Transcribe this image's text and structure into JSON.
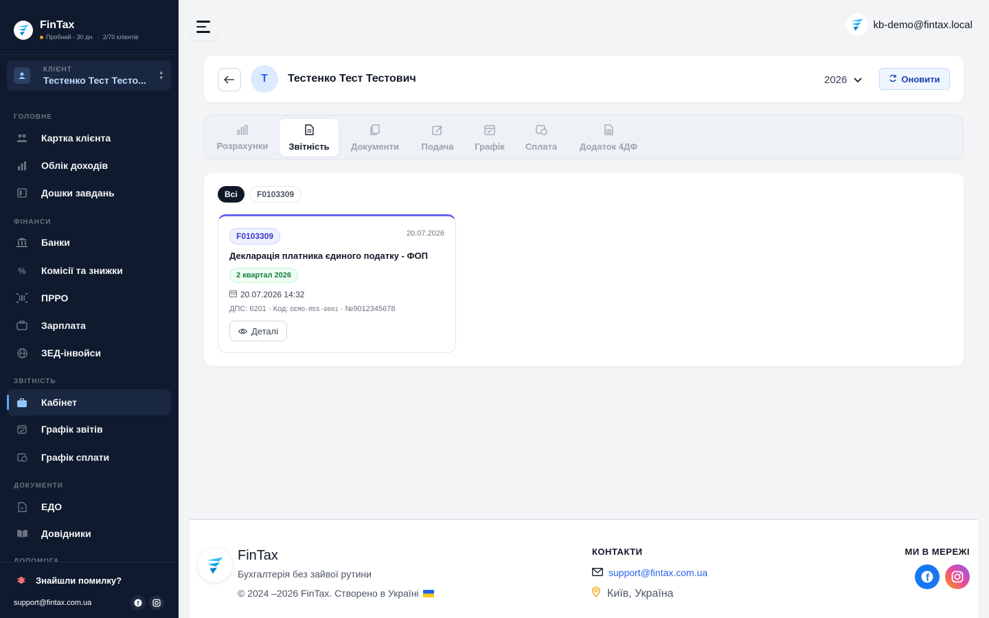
{
  "brand": {
    "name": "FinTax",
    "plan": "Пробний - 30 дн.",
    "clients": "2/70 клієнтів"
  },
  "client_selector": {
    "caption": "КЛІЄНТ",
    "name": "Тестенко Тест Тесто..."
  },
  "sidebar": {
    "sections": [
      {
        "title": "ГОЛОВНЕ",
        "items": [
          {
            "label": "Картка клієнта",
            "icon": "users-icon"
          },
          {
            "label": "Облік доходів",
            "icon": "bar-chart-icon"
          },
          {
            "label": "Дошки завдань",
            "icon": "board-icon"
          }
        ]
      },
      {
        "title": "ФІНАНСИ",
        "items": [
          {
            "label": "Банки",
            "icon": "bank-icon"
          },
          {
            "label": "Комісії та знижки",
            "icon": "percent-icon"
          },
          {
            "label": "ПРРО",
            "icon": "barcode-icon"
          },
          {
            "label": "Зарплата",
            "icon": "wallet-icon"
          },
          {
            "label": "ЗЕД-інвойси",
            "icon": "globe-icon"
          }
        ]
      },
      {
        "title": "ЗВІТНІСТЬ",
        "items": [
          {
            "label": "Кабінет",
            "icon": "briefcase-icon",
            "active": true
          },
          {
            "label": "Графік звітів",
            "icon": "calendar-check-icon"
          },
          {
            "label": "Графік сплати",
            "icon": "calendar-money-icon"
          }
        ]
      },
      {
        "title": "ДОКУМЕНТИ",
        "items": [
          {
            "label": "ЕДО",
            "icon": "document-sign-icon"
          },
          {
            "label": "Довідники",
            "icon": "book-icon"
          }
        ]
      },
      {
        "title": "ДОПОМОГА",
        "items": []
      }
    ],
    "bug_report": "Знайшли помилку?",
    "support_email": "support@fintax.com.ua"
  },
  "topbar": {
    "user_email": "kb-demo@fintax.local"
  },
  "header": {
    "avatar_letter": "Т",
    "client_full_name": "Тестенко Тест Тестович",
    "year": "2026",
    "refresh_label": "Оновити"
  },
  "tabs": [
    {
      "label": "Розрахунки",
      "icon": "bar-chart-icon"
    },
    {
      "label": "Звітність",
      "icon": "document-icon",
      "active": true
    },
    {
      "label": "Документи",
      "icon": "copy-icon"
    },
    {
      "label": "Подача",
      "icon": "edit-icon"
    },
    {
      "label": "Графік",
      "icon": "calendar-check-icon"
    },
    {
      "label": "Сплата",
      "icon": "calendar-money-icon"
    },
    {
      "label": "Додаток 4ДФ",
      "icon": "table-doc-icon"
    }
  ],
  "filters": {
    "all": "Всі",
    "form": "F0103309"
  },
  "report": {
    "form_code": "F0103309",
    "date": "20.07.2026",
    "title": "Декларація платника єдиного податку - ФОП",
    "period": "2 квартал 2026",
    "datetime": "20.07.2026 14:32",
    "meta_prefix": "ДПС: 6201 · Код: ",
    "meta_code": "DEMO-REG-0001",
    "meta_suffix": " · №9012345678",
    "details_label": "Деталі"
  },
  "footer": {
    "name": "FinTax",
    "tagline": "Бухгалтерія без зайвої рутини",
    "copyright": "© 2024 –2026 FinTax. Створено в Україні",
    "contacts_title": "КОНТАКТИ",
    "email": "support@fintax.com.ua",
    "location": "Київ, Україна",
    "social_title": "МИ В МЕРЕЖІ"
  },
  "colors": {
    "sidebar_bg": "#0f1a2e",
    "accent": "#6366f1",
    "primary": "#2563eb"
  }
}
